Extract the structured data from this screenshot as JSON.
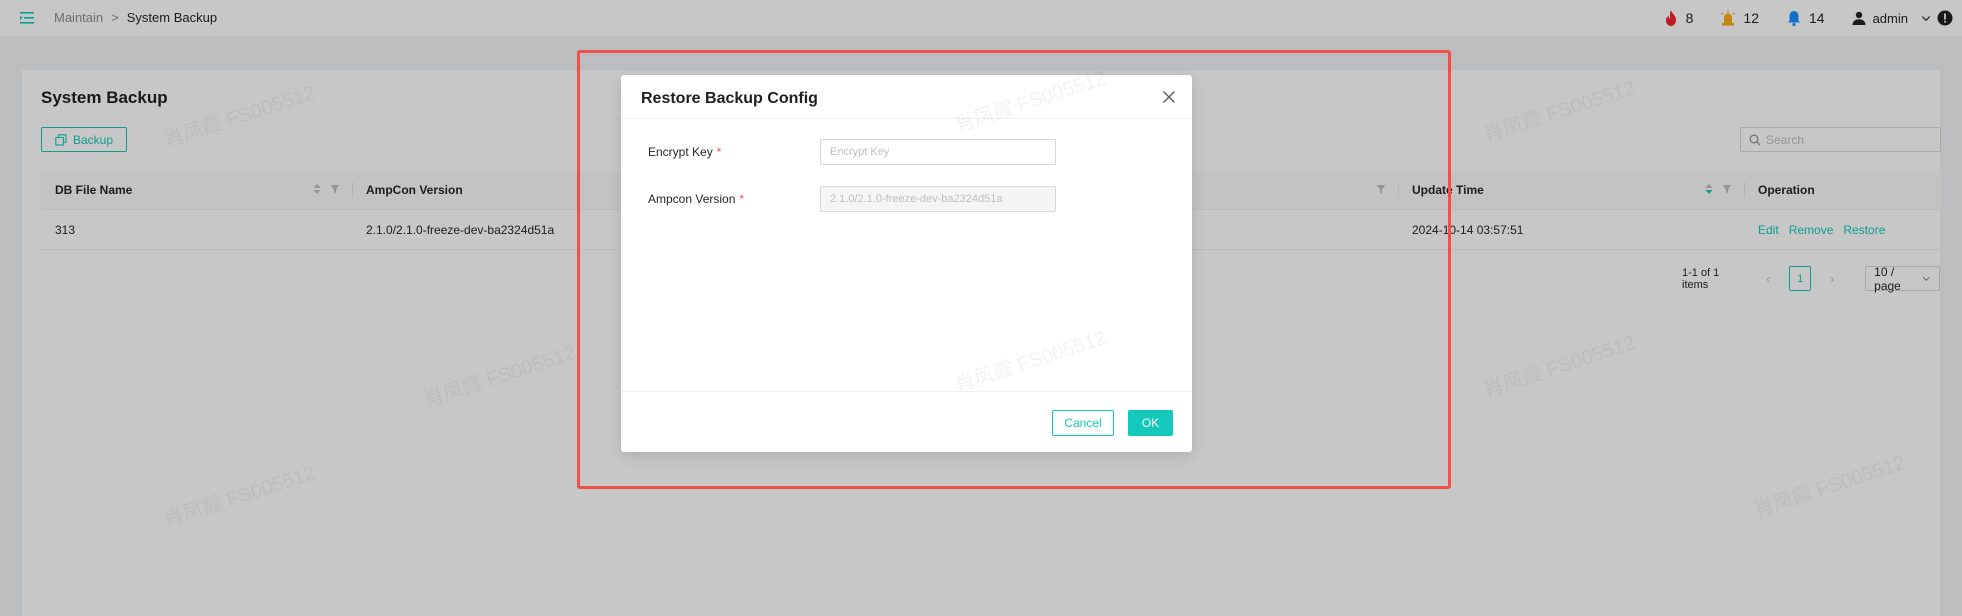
{
  "header": {
    "breadcrumb": {
      "parent": "Maintain",
      "separator": ">",
      "current": "System Backup"
    },
    "alerts": [
      {
        "icon": "fire-icon",
        "count": "8",
        "color": "#f5222d"
      },
      {
        "icon": "alarm-light-icon",
        "count": "12",
        "color": "#faad14"
      },
      {
        "icon": "bell-icon",
        "count": "14",
        "color": "#1890ff"
      }
    ],
    "user": {
      "name": "admin"
    }
  },
  "page": {
    "title": "System Backup",
    "backup_label": "Backup",
    "search_placeholder": "Search"
  },
  "table": {
    "columns": [
      "DB File Name",
      "AmpCon Version",
      "Update Time",
      "Operation"
    ],
    "rows": [
      {
        "name": "313",
        "version": "2.1.0/2.1.0-freeze-dev-ba2324d51a",
        "update_time": "2024-10-14 03:57:51",
        "actions": [
          "Edit",
          "Remove",
          "Restore"
        ]
      }
    ]
  },
  "pagination": {
    "total_text": "1-1 of 1 items",
    "current_page": "1",
    "page_size": "10 / page"
  },
  "modal": {
    "title": "Restore Backup Config",
    "fields": [
      {
        "label": "Encrypt Key",
        "value": "",
        "placeholder": "Encrypt Key",
        "required": true
      },
      {
        "label": "Ampcon Version",
        "value": "2.1.0/2.1.0-freeze-dev-ba2324d51a",
        "placeholder": "",
        "required": true
      }
    ],
    "cancel_label": "Cancel",
    "ok_label": "OK"
  },
  "watermark": "肖凤霞 FS005512",
  "colors": {
    "accent": "#14c9bb",
    "highlight": "#f0504a",
    "required": "#ff4d4f"
  }
}
